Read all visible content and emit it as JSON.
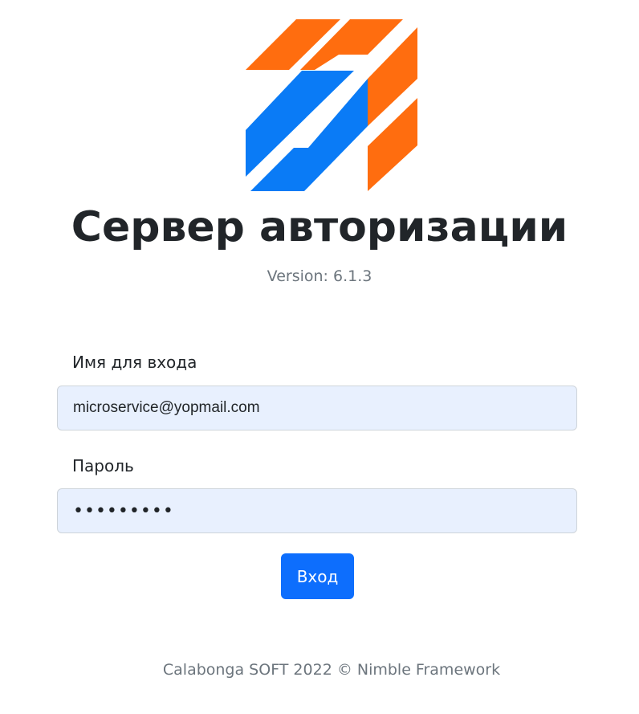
{
  "app": {
    "title": "Сервер авторизации",
    "version_text": "Version: 6.1.3",
    "logo_icon": "company-logo-icon",
    "colors": {
      "logo_orange": "#ff6d0f",
      "logo_blue": "#0a7bf6",
      "button_primary": "#0d6efd",
      "input_autofill_bg": "#e8f0fe",
      "muted_text": "#6c757d"
    }
  },
  "form": {
    "login_label": "Имя для входа",
    "login_value": "microservice@yopmail.com",
    "password_label": "Пароль",
    "password_value": "•••••••••",
    "submit_label": "Вход"
  },
  "footer": {
    "text": "Calabonga SOFT 2022 © Nimble Framework"
  }
}
